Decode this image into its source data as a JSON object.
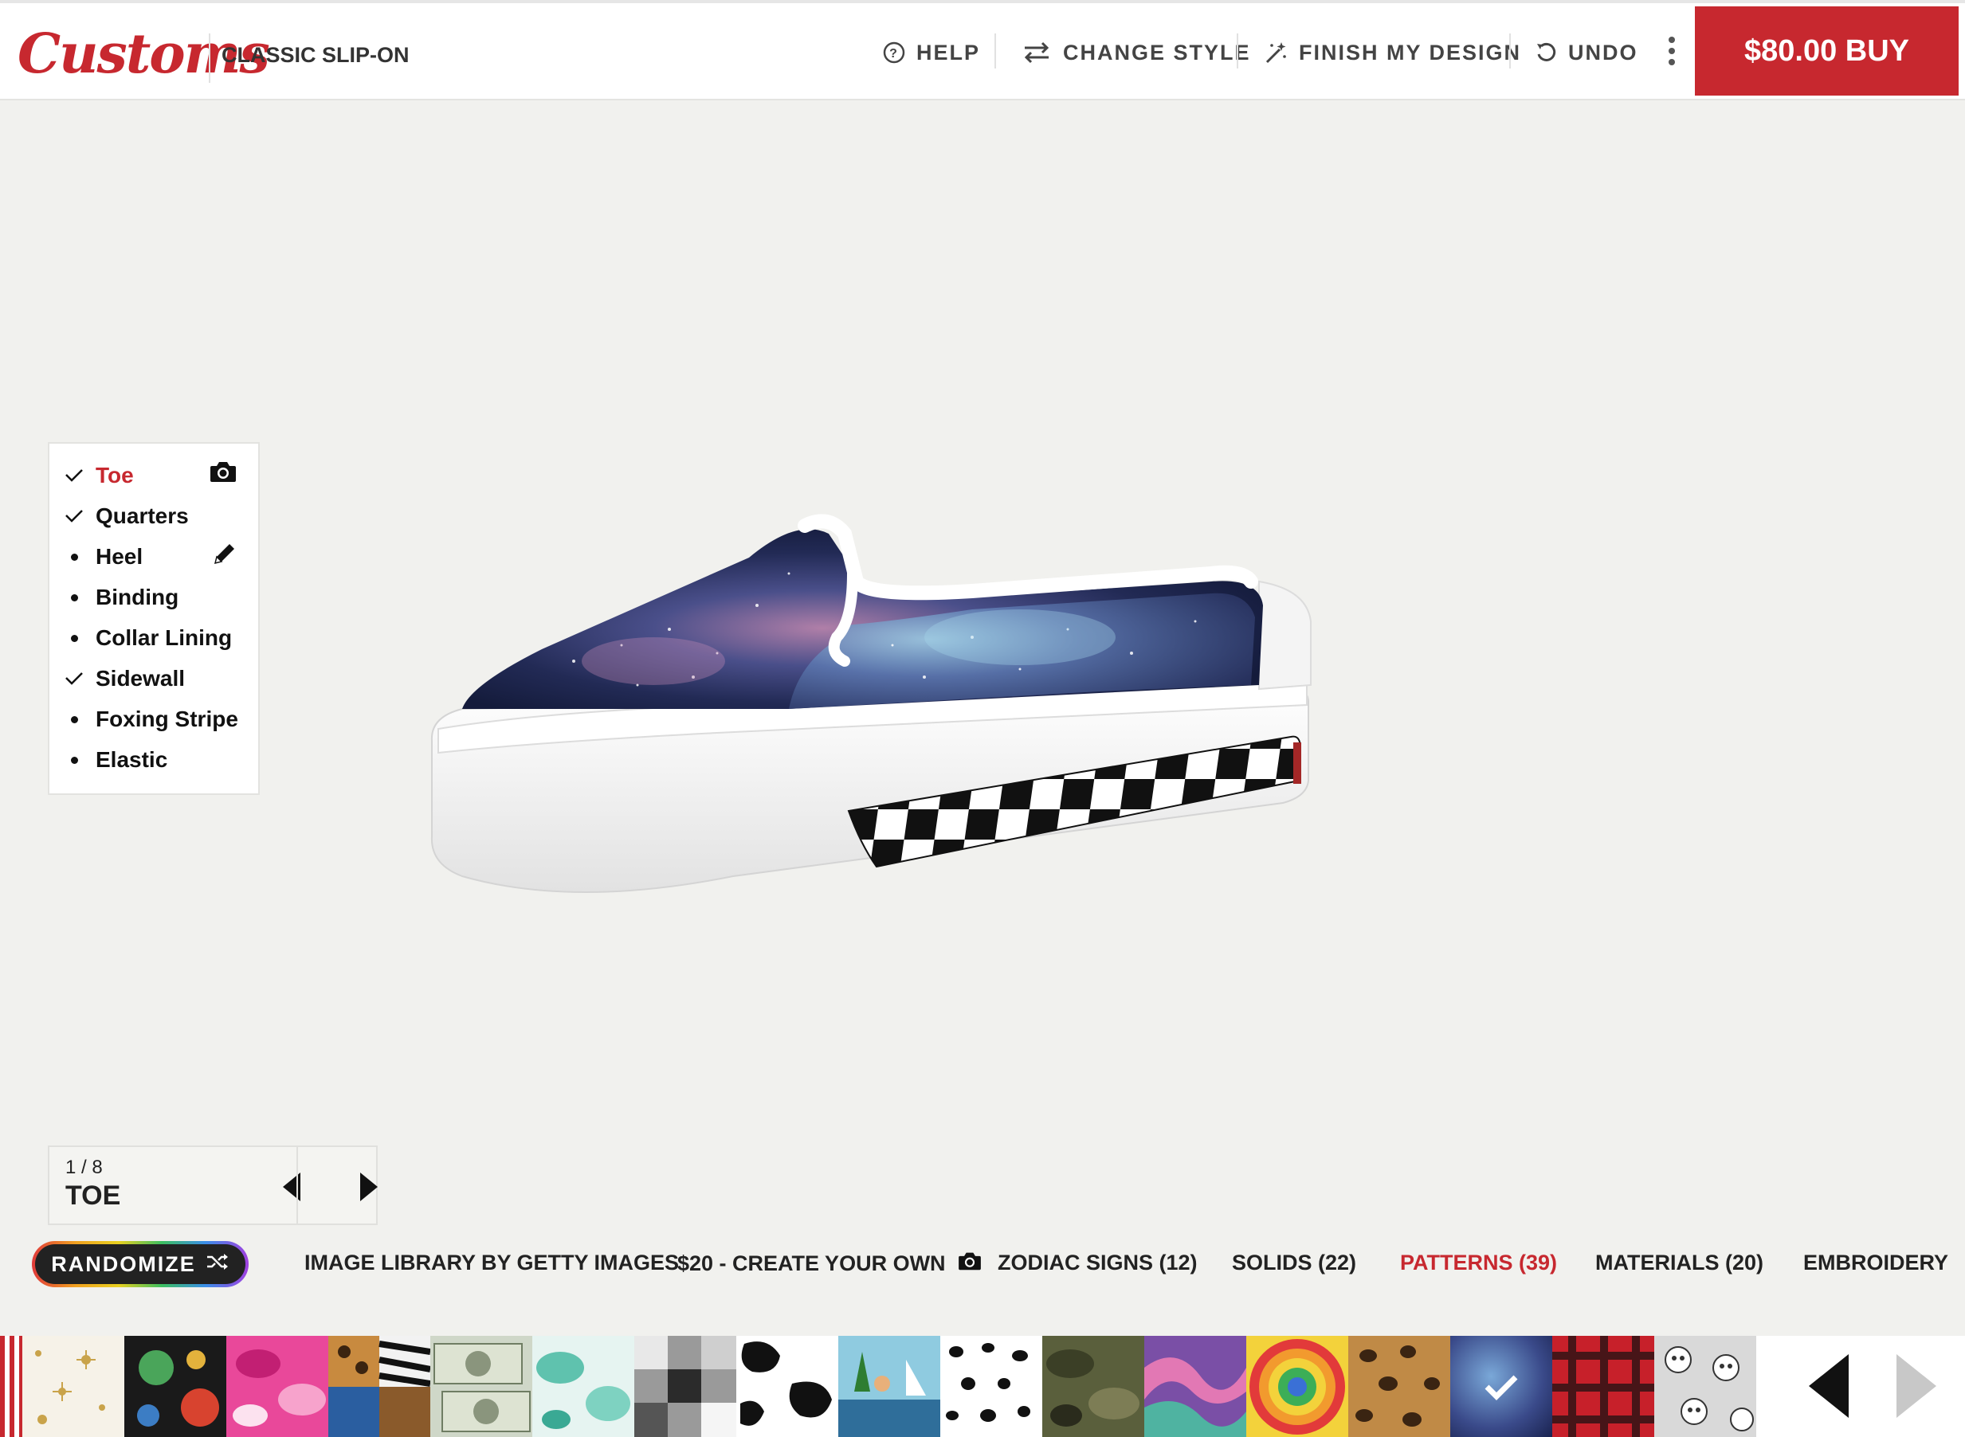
{
  "header": {
    "logo": "Customs",
    "style_name": "CLASSIC SLIP-ON",
    "nav": {
      "help": "HELP",
      "change_style": "CHANGE STYLE",
      "finish_design": "FINISH MY DESIGN",
      "undo": "UNDO"
    },
    "buy_label": "$80.00 BUY"
  },
  "parts": {
    "items": [
      {
        "label": "Toe",
        "marker": "check",
        "active": true
      },
      {
        "label": "Quarters",
        "marker": "check"
      },
      {
        "label": "Heel",
        "marker": "dot"
      },
      {
        "label": "Binding",
        "marker": "dot"
      },
      {
        "label": "Collar Lining",
        "marker": "dot"
      },
      {
        "label": "Sidewall",
        "marker": "check"
      },
      {
        "label": "Foxing Stripe",
        "marker": "dot"
      },
      {
        "label": "Elastic",
        "marker": "dot"
      }
    ]
  },
  "part_nav": {
    "counter": "1 / 8",
    "current": "TOE"
  },
  "categories": {
    "randomize": "RANDOMIZE",
    "items": [
      {
        "label": "IMAGE LIBRARY BY GETTY IMAGES"
      },
      {
        "label": "$20 - CREATE YOUR OWN"
      },
      {
        "label": "ZODIAC SIGNS (12)"
      },
      {
        "label": "SOLIDS (22)"
      },
      {
        "label": "PATTERNS (39)",
        "active": true
      },
      {
        "label": "MATERIALS (20)"
      },
      {
        "label": "EMBROIDERY"
      }
    ]
  },
  "colors": {
    "brand_red": "#c7282f",
    "background": "#f1f1ee"
  },
  "swatches": [
    {
      "name": "gold-stars-pattern",
      "selected": false
    },
    {
      "name": "monster-pattern",
      "selected": false
    },
    {
      "name": "pink-camo-pattern",
      "selected": false
    },
    {
      "name": "animal-collage-pattern",
      "selected": false
    },
    {
      "name": "money-pattern",
      "selected": false
    },
    {
      "name": "teal-tie-dye-pattern",
      "selected": false
    },
    {
      "name": "gray-patchwork-pattern",
      "selected": false
    },
    {
      "name": "cow-print-pattern",
      "selected": false
    },
    {
      "name": "hula-sailboat-pattern",
      "selected": false
    },
    {
      "name": "dalmatian-pattern",
      "selected": false
    },
    {
      "name": "green-camo-pattern",
      "selected": false
    },
    {
      "name": "paint-swirl-pattern",
      "selected": false
    },
    {
      "name": "rainbow-tie-dye-pattern",
      "selected": false
    },
    {
      "name": "leopard-pattern",
      "selected": false
    },
    {
      "name": "galaxy-pattern",
      "selected": true
    },
    {
      "name": "red-plaid-pattern",
      "selected": false
    },
    {
      "name": "skulls-pattern",
      "selected": false
    }
  ]
}
